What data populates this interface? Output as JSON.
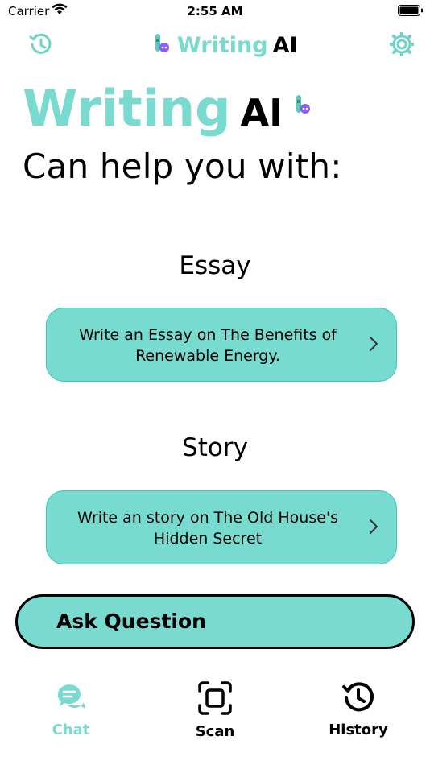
{
  "status": {
    "carrier": "Carrier",
    "time": "2:55 AM"
  },
  "nav": {
    "brand_word": "Writing",
    "brand_ai": "AI"
  },
  "hero": {
    "word": "Writing",
    "ai": "AI",
    "subtitle": "Can help you with:"
  },
  "sections": [
    {
      "title": "Essay",
      "prompt": "Write an Essay on The Benefits of Renewable Energy."
    },
    {
      "title": "Story",
      "prompt": "Write an story on The Old House's Hidden Secret"
    }
  ],
  "ask_button": "Ask Question",
  "tabs": [
    {
      "label": "Chat",
      "icon": "chat-icon",
      "active": true
    },
    {
      "label": "Scan",
      "icon": "scan-icon",
      "active": false
    },
    {
      "label": "History",
      "icon": "history-icon",
      "active": false
    }
  ],
  "colors": {
    "accent": "#79dacf",
    "card": "#77dbd0",
    "text": "#000000"
  }
}
